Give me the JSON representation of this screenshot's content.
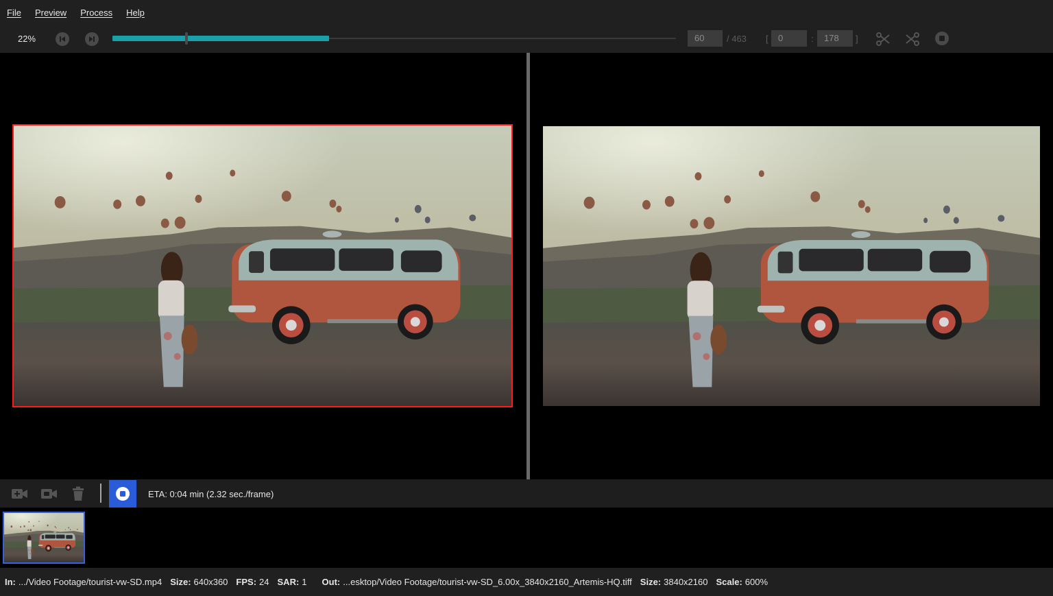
{
  "menu": [
    {
      "label": "File"
    },
    {
      "label": "Preview"
    },
    {
      "label": "Process"
    },
    {
      "label": "Help"
    }
  ],
  "toolbar": {
    "zoom": "22%",
    "progress_fraction": 0.385,
    "current_frame": "60",
    "total_frames": "/ 463",
    "range_open": "[",
    "range_start": "0",
    "range_sep": ":",
    "range_end": "178",
    "range_close": "]"
  },
  "controlbar": {
    "eta": "ETA:  0:04 min  (2.32 sec./frame)"
  },
  "status": {
    "in_label": "In:",
    "in_value": ".../Video Footage/tourist-vw-SD.mp4",
    "size_label": "Size:",
    "size_value": "640x360",
    "fps_label": "FPS:",
    "fps_value": "24",
    "sar_label": "SAR:",
    "sar_value": "1",
    "out_label": "Out:",
    "out_value": "...esktop/Video Footage/tourist-vw-SD_6.00x_3840x2160_Artemis-HQ.tiff",
    "out_size_label": "Size:",
    "out_size_value": "3840x2160",
    "scale_label": "Scale:",
    "scale_value": "600%"
  },
  "icons": {
    "prev": "skip-back-icon",
    "next": "skip-forward-icon",
    "cut": "scissors-icon",
    "cut_split": "split-scissors-icon",
    "stop": "stop-icon",
    "add_video": "add-video-icon",
    "video": "video-icon",
    "trash": "trash-icon"
  },
  "colors": {
    "accent": "#1aa0a8",
    "stop_button": "#2a5bd8",
    "selection_border": "#ff1a1a"
  }
}
